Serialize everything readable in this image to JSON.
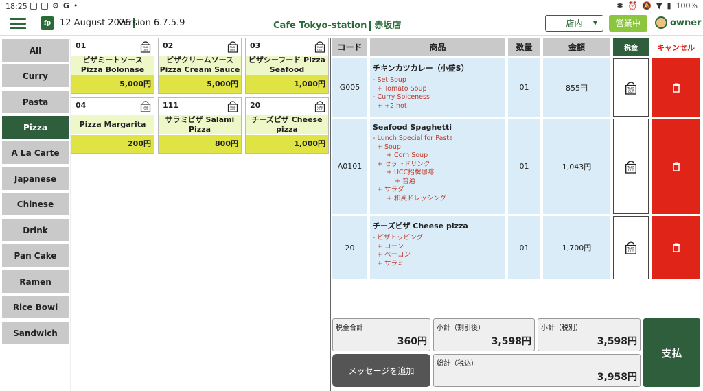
{
  "status_bar": {
    "time": "18:25",
    "icons_left": [
      "settings-icon",
      "sim-icon",
      "gear-icon",
      "google-icon",
      "dot-icon"
    ],
    "battery": "100%"
  },
  "header": {
    "logo_text": "fp",
    "date": "12 August 2026",
    "version": "Version 6.7.5.9",
    "store": "Cafe Tokyo-station",
    "branch": "赤坂店",
    "dine_mode": "店内",
    "open_status": "営業中",
    "user": "owner"
  },
  "categories": [
    {
      "label": "All",
      "active": false
    },
    {
      "label": "Curry",
      "active": false
    },
    {
      "label": "Pasta",
      "active": false
    },
    {
      "label": "Pizza",
      "active": true
    },
    {
      "label": "A La Carte",
      "active": false
    },
    {
      "label": "Japanese",
      "active": false
    },
    {
      "label": "Chinese",
      "active": false
    },
    {
      "label": "Drink",
      "active": false
    },
    {
      "label": "Pan Cake",
      "active": false
    },
    {
      "label": "Ramen",
      "active": false
    },
    {
      "label": "Rice Bowl",
      "active": false
    },
    {
      "label": "Sandwich",
      "active": false
    }
  ],
  "products": [
    {
      "code": "01",
      "name": "ピザミートソース Pizza Bolonase",
      "price": "5,000円"
    },
    {
      "code": "02",
      "name": "ピザクリームソース Pizza Cream Sauce",
      "price": "5,000円"
    },
    {
      "code": "03",
      "name": "ピザシーフード Pizza Seafood",
      "price": "1,000円"
    },
    {
      "code": "04",
      "name": "Pizza Margarita",
      "price": "200円"
    },
    {
      "code": "111",
      "name": "サラミピザ Salami Pizza",
      "price": "800円"
    },
    {
      "code": "20",
      "name": "チーズピザ Cheese pizza",
      "price": "1,000円"
    }
  ],
  "order_table": {
    "headers": {
      "code": "コード",
      "item": "商品",
      "qty": "数量",
      "amount": "金額",
      "tax": "税金",
      "cancel": "キャンセル"
    },
    "rows": [
      {
        "code": "G005",
        "name": "チキンカツカレー（小盛S）",
        "options": [
          "- Set Soup",
          "    + Tomato Soup",
          "- Curry Spiceness",
          "    + +2 hot"
        ],
        "qty": "01",
        "amount": "855円"
      },
      {
        "code": "A0101",
        "name": "Seafood Spaghetti",
        "options": [
          "- Lunch Special for Pasta",
          "    + Soup",
          "        + Corn Soup",
          "    + セットドリンク",
          "        + UCC招牌咖啡",
          "            + 普通",
          "    + サラダ",
          "        + 和風ドレッシング"
        ],
        "qty": "01",
        "amount": "1,043円"
      },
      {
        "code": "20",
        "name": "チーズピザ Cheese pizza",
        "options": [
          "- ピザトッピング",
          "    + コーン",
          "    + ベーコン",
          "    + サラミ"
        ],
        "qty": "01",
        "amount": "1,700円"
      }
    ]
  },
  "totals": {
    "tax_total_label": "税金合計",
    "tax_total_value": "360円",
    "subtotal_discount_label": "小計（割引後）",
    "subtotal_discount_value": "3,598円",
    "subtotal_notax_label": "小計（税別）",
    "subtotal_notax_value": "3,598円",
    "add_message_label": "メッセージを追加",
    "grand_total_label": "総計（税込）",
    "grand_total_value": "3,958円",
    "pay_label": "支払"
  },
  "colors": {
    "brand_green": "#2e5e3b",
    "accent_green": "#8cc63f",
    "product_name_bg": "#eef7c8",
    "product_price_bg": "#dfe343",
    "order_row_bg": "#d9ecf7",
    "cancel_red": "#e02418"
  }
}
